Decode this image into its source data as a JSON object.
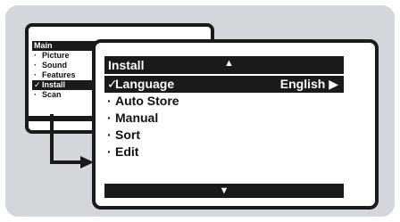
{
  "main_menu": {
    "title": "Main",
    "items": [
      {
        "label": "Picture",
        "marker": "·",
        "selected": false
      },
      {
        "label": "Sound",
        "marker": "·",
        "selected": false
      },
      {
        "label": "Features",
        "marker": "·",
        "selected": false
      },
      {
        "label": "Install",
        "marker": "✓",
        "selected": true
      },
      {
        "label": "Scan",
        "marker": "·",
        "selected": false
      }
    ]
  },
  "install_menu": {
    "title": "Install",
    "up_arrow": "▲",
    "down_arrow": "▼",
    "items": [
      {
        "label": "Language",
        "marker": "✓",
        "value": "English ▶",
        "selected": true
      },
      {
        "label": "Auto Store",
        "marker": "·",
        "value": "",
        "selected": false
      },
      {
        "label": "Manual",
        "marker": "·",
        "value": "",
        "selected": false
      },
      {
        "label": "Sort",
        "marker": "·",
        "value": "",
        "selected": false
      },
      {
        "label": "Edit",
        "marker": "·",
        "value": "",
        "selected": false
      }
    ]
  },
  "colors": {
    "background_panel": "#d3d6db",
    "menu_dark": "#1a1a1a",
    "menu_light": "#ffffff"
  }
}
